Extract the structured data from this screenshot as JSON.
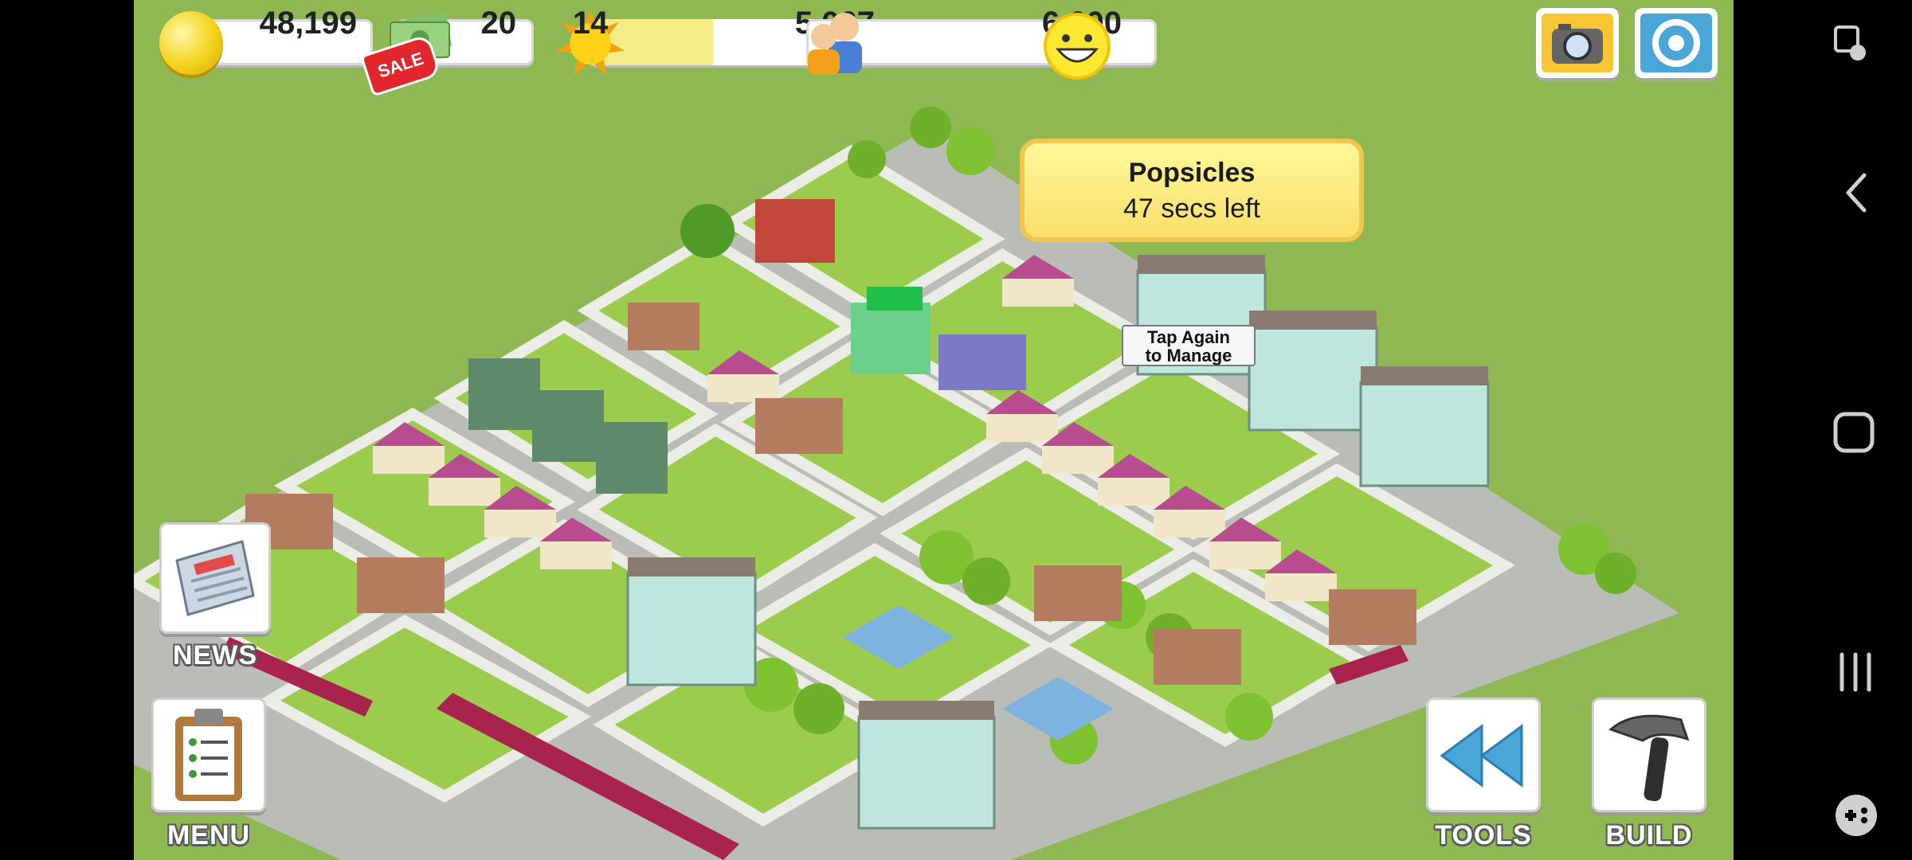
{
  "hud": {
    "coins": "48,199",
    "cash": "20",
    "sale_badge": "SALE",
    "level": "14",
    "xp": "5,067",
    "xp_progress": 0.38,
    "population": "6,600",
    "happiness_icon": "smiley-face-icon"
  },
  "tooltip": {
    "title": "Popsicles",
    "subtitle": "47 secs left"
  },
  "tap_label": {
    "line1": "Tap Again",
    "line2": "to Manage"
  },
  "buttons": {
    "news": "NEWS",
    "menu": "MENU",
    "tools": "TOOLS",
    "build": "BUILD"
  },
  "top_right_icons": [
    "camera-icon",
    "social-share-icon"
  ],
  "android_nav": [
    "screen-rotate-icon",
    "back-icon",
    "home-icon",
    "recents-icon",
    "game-tools-icon"
  ],
  "colors": {
    "grass": "#8fb752",
    "road": "#c8c8c4",
    "accent_yellow": "#f8e06a"
  }
}
